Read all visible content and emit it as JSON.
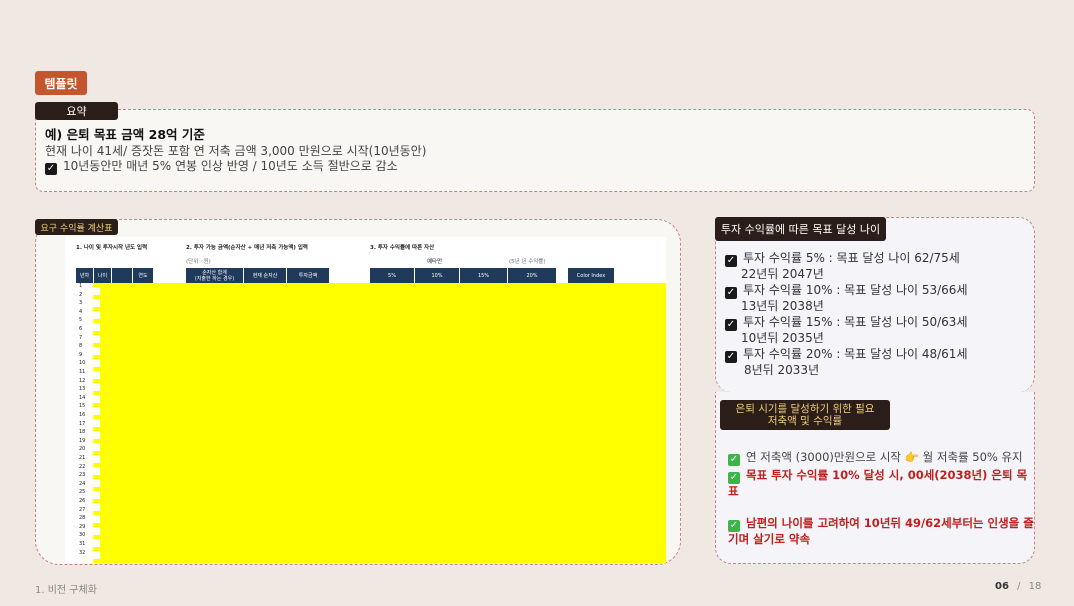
{
  "template_badge": "템플릿",
  "summary": {
    "badge": "요약",
    "title": "예) 은퇴 목표 금액 28억 기준",
    "line1": "현재 나이 41세/ 증잣돈 포함 연 저축 금액 3,000 만원으로 시작(10년동안)",
    "check1": "10년동안만 매년 5% 연봉 인상 반영 / 10년도 소득 절반으로 감소"
  },
  "calc": {
    "badge": "요구 수익률 계산표",
    "sections": [
      "1. 나이 및 투자시작 년도 입력",
      "2. 투자 가능 금액(순자산 + 매년 저축 가능액) 입력",
      "3. 투자 수익률에 따른 자산"
    ],
    "unit_note": "(단위 : 원)",
    "headers_left": [
      "년차",
      "나이",
      "",
      "연도"
    ],
    "headers_mid": [
      "순자산 합계\n(지출한 하는 경우)",
      "현재 순자산",
      "투자금액"
    ],
    "rate_top_left": "예타만",
    "rate_top_right": "(5년 년 수익률)",
    "headers_rates": [
      "5%",
      "10%",
      "15%",
      "20%"
    ],
    "color_index": "Color Index",
    "rows": [
      "1",
      "2",
      "3",
      "4",
      "5",
      "6",
      "7",
      "8",
      "9",
      "10",
      "11",
      "12",
      "13",
      "14",
      "15",
      "16",
      "17",
      "18",
      "19",
      "20",
      "21",
      "22",
      "23",
      "24",
      "25",
      "26",
      "27",
      "28",
      "29",
      "30",
      "31",
      "32"
    ]
  },
  "target_age": {
    "badge": "투자 수익률에 따른 목표 달성 나이",
    "items": [
      {
        "line1": "투자 수익률 5% : 목표 달성 나이 62/75세",
        "line2": "22년뒤 2047년"
      },
      {
        "line1": "투자 수익률 10% : 목표 달성 나이 53/66세",
        "line2": "13년뒤 2038년"
      },
      {
        "line1": "투자 수익률 15% : 목표 달성 나이 50/63세",
        "line2": "10년뒤 2035년"
      },
      {
        "line1": "투자 수익률 20% : 목표 달성 나이 48/61세",
        "line2": "8년뒤 2033년"
      }
    ]
  },
  "required": {
    "badge_line1": "은퇴 시기를 달성하기 위한 필요",
    "badge_line2": "저축액 및 수익률",
    "item1": "연 저축액 (3000)만원으로 시작 👉 월 저축률 50% 유지",
    "item2": "목표 투자 수익률 10% 달성 시, 00세(2038년) 은퇴 목표",
    "item3": "남편의 나이를 고려하여 10년뒤 49/62세부터는 인생을 즐기며 살기로 약속"
  },
  "footer": {
    "section": "1. 비전 구체화",
    "page_current": "06",
    "page_sep": "/",
    "page_total": "18"
  },
  "colors": {
    "accent": "#c4552c",
    "dark": "#2b1e18",
    "sheet_header": "#203a5c",
    "highlight": "#ffff00",
    "red_text": "#c0201c"
  }
}
